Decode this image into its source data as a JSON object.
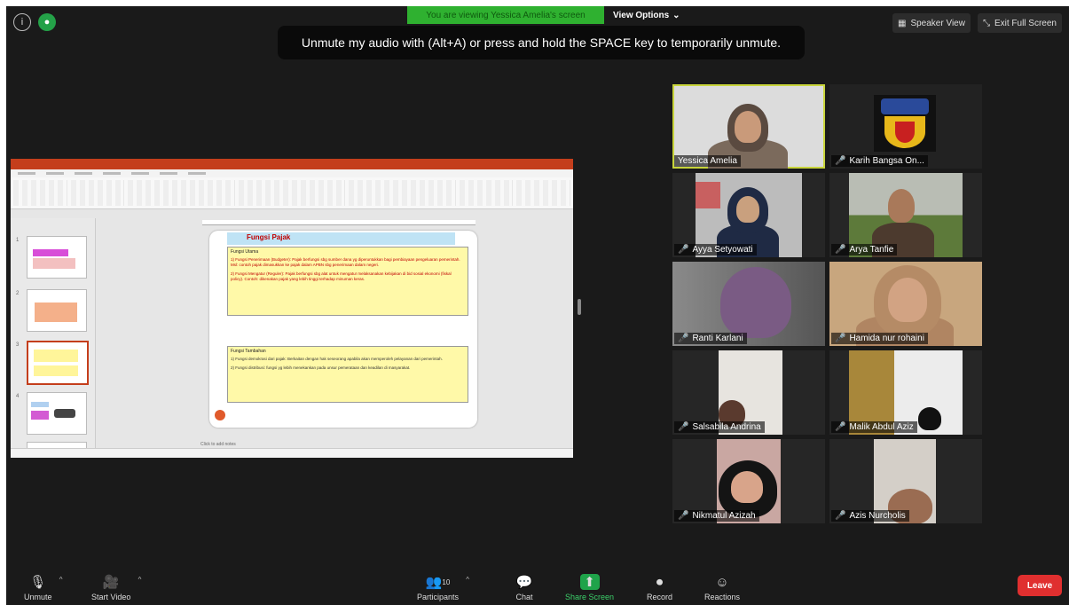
{
  "top": {
    "banner": "You are viewing Yessica Amelia's screen",
    "view_options": "View Options",
    "speaker_view": "Speaker View",
    "exit_fullscreen": "Exit Full Screen",
    "unmute_tip": "Unmute my audio with (Alt+A) or press and hold the SPACE key to temporarily unmute."
  },
  "slide": {
    "title": "Fungsi Pajak",
    "box1_heading": "Fungsi Utama",
    "box1_item1": "1) Fungsi Penerimaan (Budgeter): Pajak berfungsi sbg sumber dana yg diperuntukkan bagi pembiayaan pengeluaran pemerintah. Msl: contoh pajak dimasukkan ke pajak dalam APBN sbg penerimaan dalam negeri.",
    "box1_item2": "2) Fungsi Mengatur (Reguler): Pajak berfungsi sbg alat untuk mengatur melaksanakan kebijakan di bid sosial ekonomi (fiskal policy). Contoh: dikenakan pajak yang lebih tinggi terhadap minuman keras.",
    "box2_heading": "Fungsi Tambahan",
    "box2_item1": "1) Fungsi demokrasi dari pajak: Berkaitan dengan hak seseorang apabila akan memperoleh pelayanan dari pemerintah.",
    "box2_item2": "2) Fungsi distribusi: fungsi yg lebih menekankan pada unsur pemerataan dan keadilan di masyarakat.",
    "notes": "Click to add notes"
  },
  "participants": [
    {
      "name": "Yessica Amelia",
      "muted": false
    },
    {
      "name": "Karih Bangsa On...",
      "muted": true
    },
    {
      "name": "Ayya Setyowati",
      "muted": true
    },
    {
      "name": "Arya Tanfie",
      "muted": true
    },
    {
      "name": "Ranti Karlani",
      "muted": true
    },
    {
      "name": "Hamida nur rohaini",
      "muted": true
    },
    {
      "name": "Salsabila Andrina",
      "muted": true
    },
    {
      "name": "Malik Abdul Aziz",
      "muted": true
    },
    {
      "name": "Nikmatul Azizah",
      "muted": true
    },
    {
      "name": "Azis Nurcholis",
      "muted": true
    }
  ],
  "toolbar": {
    "unmute": "Unmute",
    "start_video": "Start Video",
    "participants": "Participants",
    "participants_count": "10",
    "chat": "Chat",
    "share_screen": "Share Screen",
    "record": "Record",
    "reactions": "Reactions",
    "leave": "Leave"
  },
  "colors": {
    "banner_green": "#2fb130",
    "leave_red": "#e02f2f",
    "active_speaker": "#c8d43b",
    "ppt_accent": "#c43e1c"
  }
}
